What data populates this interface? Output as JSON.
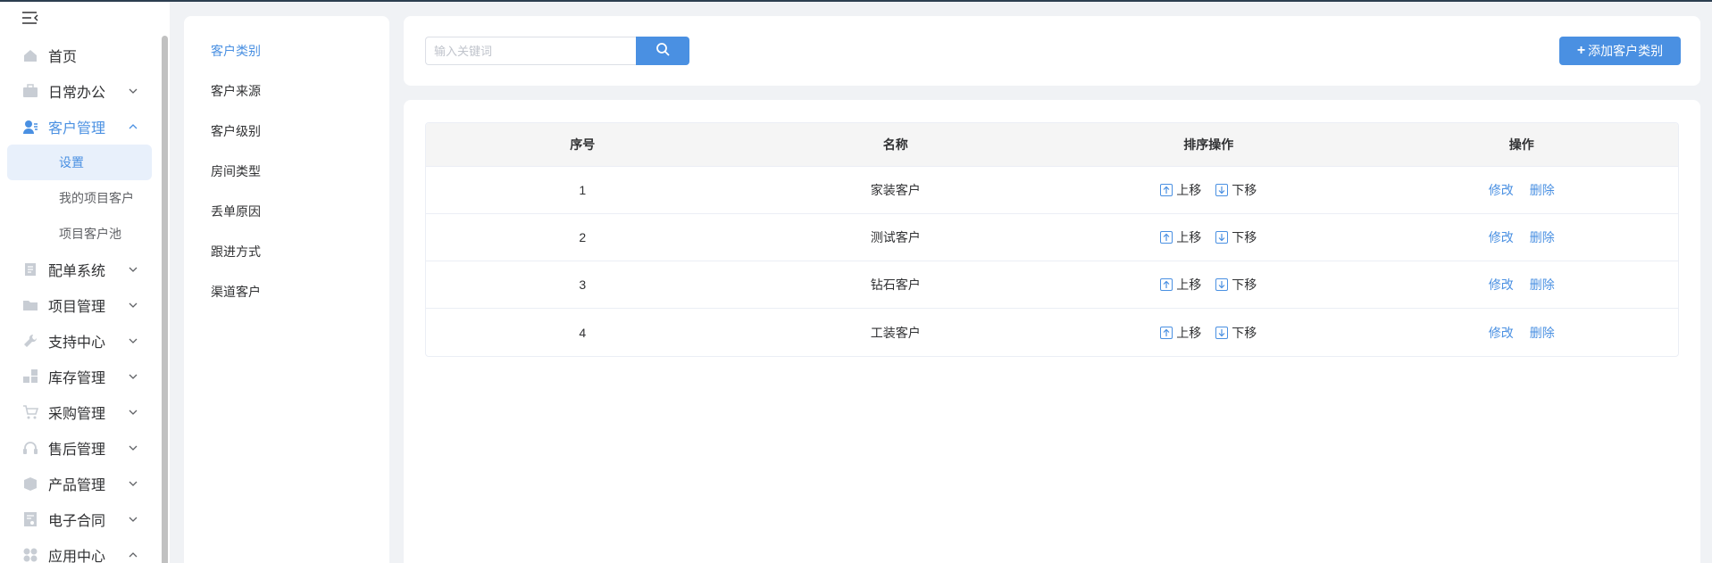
{
  "sidebar": {
    "menu": [
      {
        "label": "首页",
        "icon": "home-icon",
        "has_chevron": false
      },
      {
        "label": "日常办公",
        "icon": "briefcase-icon",
        "has_chevron": true
      },
      {
        "label": "客户管理",
        "icon": "customer-icon",
        "has_chevron": true,
        "expanded": true
      }
    ],
    "submenu": [
      {
        "label": "设置",
        "active": true
      },
      {
        "label": "我的项目客户"
      },
      {
        "label": "项目客户池"
      }
    ],
    "menu_rest": [
      {
        "label": "配单系统",
        "icon": "document-icon"
      },
      {
        "label": "项目管理",
        "icon": "folder-icon"
      },
      {
        "label": "支持中心",
        "icon": "wrench-icon"
      },
      {
        "label": "库存管理",
        "icon": "inventory-icon"
      },
      {
        "label": "采购管理",
        "icon": "cart-icon"
      },
      {
        "label": "售后管理",
        "icon": "headset-icon"
      },
      {
        "label": "产品管理",
        "icon": "box-icon"
      },
      {
        "label": "电子合同",
        "icon": "contract-icon"
      },
      {
        "label": "应用中心",
        "icon": "apps-icon"
      }
    ]
  },
  "categories": {
    "items": [
      "客户类别",
      "客户来源",
      "客户级别",
      "房间类型",
      "丢单原因",
      "跟进方式",
      "渠道客户"
    ],
    "active_index": 0
  },
  "toolbar": {
    "search_placeholder": "输入关键词",
    "search_value": "",
    "add_label": "添加客户类别"
  },
  "table": {
    "headers": [
      "序号",
      "名称",
      "排序操作",
      "操作"
    ],
    "rows": [
      {
        "index": "1",
        "name": "家装客户"
      },
      {
        "index": "2",
        "name": "测试客户"
      },
      {
        "index": "3",
        "name": "钻石客户"
      },
      {
        "index": "4",
        "name": "工装客户"
      }
    ],
    "sort_up_label": "上移",
    "sort_down_label": "下移",
    "edit_label": "修改",
    "delete_label": "删除"
  },
  "colors": {
    "accent": "#4a90e2",
    "background": "#f0f2f5"
  }
}
